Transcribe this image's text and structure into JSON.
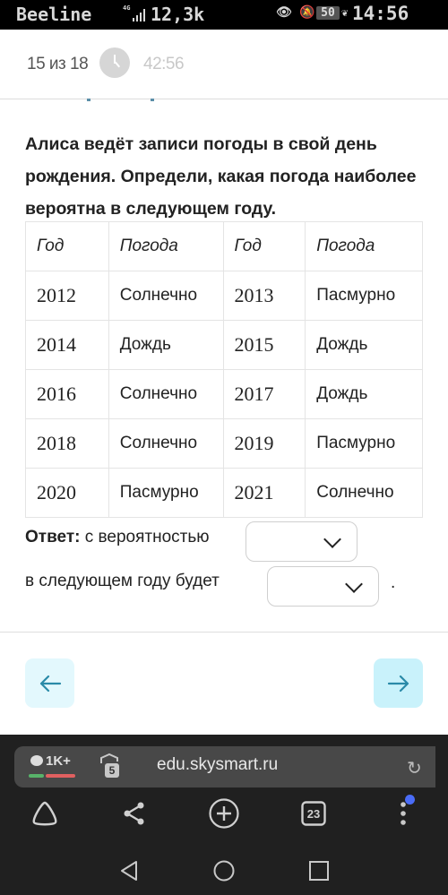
{
  "status_bar": {
    "carrier": "Beeline",
    "network": "4G",
    "speed": "12,3k",
    "battery": "50",
    "time": "14:56",
    "icons": [
      "eye-icon",
      "bell-off-icon",
      "battery-icon",
      "leaf-icon"
    ]
  },
  "header": {
    "progress": "15 из 18",
    "timer": "42:56"
  },
  "question": {
    "text": "Алиса ведёт записи погоды в свой день рождения. Определи, какая погода наиболее вероятна в следующем году."
  },
  "table": {
    "headers": [
      "Год",
      "Погода",
      "Год",
      "Погода"
    ],
    "rows": [
      [
        "2012",
        "Солнечно",
        "2013",
        "Пасмурно"
      ],
      [
        "2014",
        "Дождь",
        "2015",
        "Дождь"
      ],
      [
        "2016",
        "Солнечно",
        "2017",
        "Дождь"
      ],
      [
        "2018",
        "Солнечно",
        "2019",
        "Пасмурно"
      ],
      [
        "2020",
        "Пасмурно",
        "2021",
        "Солнечно"
      ]
    ]
  },
  "answer": {
    "label": "Ответ:",
    "line1": "с вероятностью",
    "line2": "в следующем году будет",
    "select1_value": "",
    "select2_value": "",
    "period": "."
  },
  "navigation": {
    "prev": "←",
    "next": "→"
  },
  "browser": {
    "comments": "1K+",
    "tabs_count": "5",
    "url": "edu.skysmart.ru",
    "tab_switcher_count": "23"
  },
  "colors": {
    "nav_prev_bg": "#e3f8fd",
    "nav_next_bg": "#c9f2fb",
    "nav_arrow": "#2a8aa8",
    "notify_dot": "#4a6cf7"
  }
}
